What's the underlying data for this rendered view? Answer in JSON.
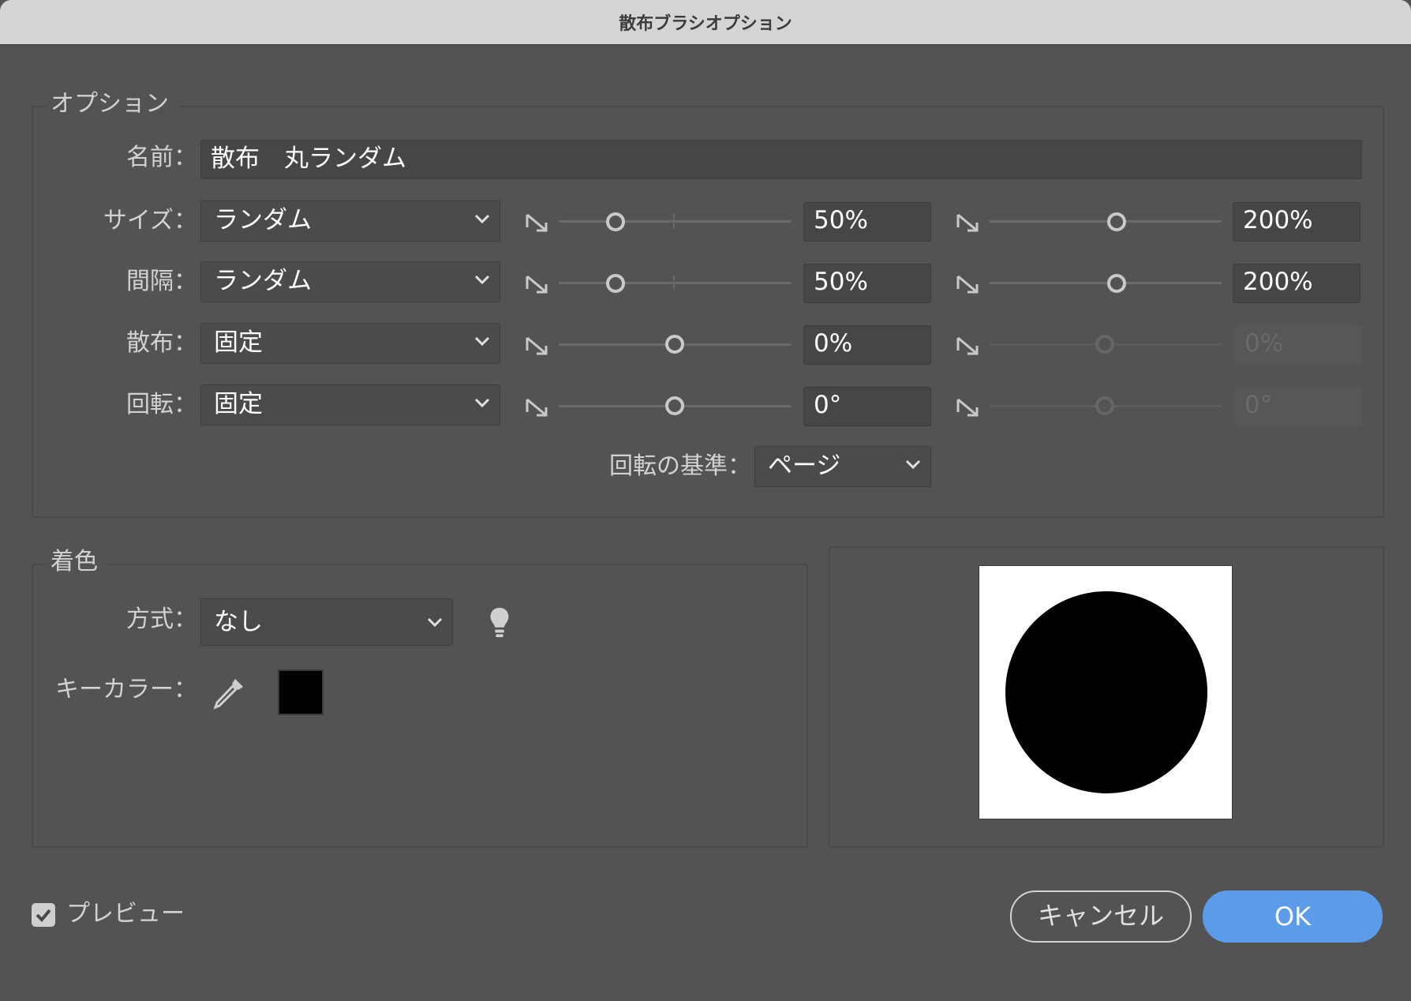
{
  "window": {
    "title": "散布ブラシオプション"
  },
  "options": {
    "legend": "オプション",
    "name_label": "名前：",
    "name_value": "散布　丸ランダム",
    "rows": [
      {
        "label": "サイズ：",
        "mode": "ランダム",
        "min_value": "50%",
        "max_value": "200%",
        "max_disabled": false
      },
      {
        "label": "間隔：",
        "mode": "ランダム",
        "min_value": "50%",
        "max_value": "200%",
        "max_disabled": false
      },
      {
        "label": "散布：",
        "mode": "固定",
        "min_value": "0%",
        "max_value": "0%",
        "max_disabled": true
      },
      {
        "label": "回転：",
        "mode": "固定",
        "min_value": "0°",
        "max_value": "0°",
        "max_disabled": true
      }
    ],
    "rotation_ref_label": "回転の基準：",
    "rotation_ref_value": "ページ"
  },
  "coloring": {
    "legend": "着色",
    "method_label": "方式：",
    "method_value": "なし",
    "key_color_label": "キーカラー：",
    "key_color": "#000000"
  },
  "preview": {
    "shape": "circle",
    "fill": "#000000"
  },
  "footer": {
    "preview_label": "プレビュー",
    "preview_checked": true,
    "cancel_label": "キャンセル",
    "ok_label": "OK",
    "ok_color": "#5b9be8"
  }
}
